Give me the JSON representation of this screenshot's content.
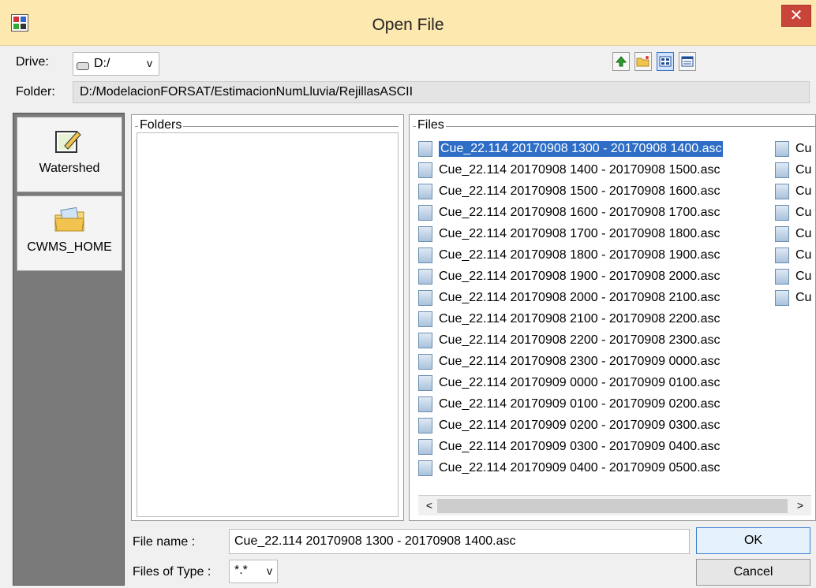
{
  "window": {
    "title": "Open File",
    "close_glyph": "✕"
  },
  "drive": {
    "label": "Drive:",
    "value": "D:/",
    "arrow": "v"
  },
  "folder": {
    "label": "Folder:",
    "path": "D:/ModelacionFORSAT/EstimacionNumLluvia/RejillasASCII"
  },
  "toolbar": {
    "icons": [
      "up-folder-icon",
      "new-folder-icon",
      "list-view-icon",
      "details-view-icon"
    ]
  },
  "shortcuts": [
    {
      "label": "Watershed",
      "icon": "watershed-icon"
    },
    {
      "label": "CWMS_HOME",
      "icon": "folder-icon"
    }
  ],
  "panels": {
    "folders_title": "Folders",
    "files_title": "Files"
  },
  "files": [
    "Cue_22.114 20170908 1300 - 20170908 1400.asc",
    "Cue_22.114 20170908 1400 - 20170908 1500.asc",
    "Cue_22.114 20170908 1500 - 20170908 1600.asc",
    "Cue_22.114 20170908 1600 - 20170908 1700.asc",
    "Cue_22.114 20170908 1700 - 20170908 1800.asc",
    "Cue_22.114 20170908 1800 - 20170908 1900.asc",
    "Cue_22.114 20170908 1900 - 20170908 2000.asc",
    "Cue_22.114 20170908 2000 - 20170908 2100.asc",
    "Cue_22.114 20170908 2100 - 20170908 2200.asc",
    "Cue_22.114 20170908 2200 - 20170908 2300.asc",
    "Cue_22.114 20170908 2300 - 20170909 0000.asc",
    "Cue_22.114 20170909 0000 - 20170909 0100.asc",
    "Cue_22.114 20170909 0100 - 20170909 0200.asc",
    "Cue_22.114 20170909 0200 - 20170909 0300.asc",
    "Cue_22.114 20170909 0300 - 20170909 0400.asc",
    "Cue_22.114 20170909 0400 - 20170909 0500.asc"
  ],
  "selected_file_index": 0,
  "second_column": [
    "Cu",
    "Cu",
    "Cu",
    "Cu",
    "Cu",
    "Cu",
    "Cu",
    "Cu"
  ],
  "scroll": {
    "left_arrow": "<",
    "right_arrow": ">"
  },
  "filename": {
    "label": "File name :",
    "value": "Cue_22.114 20170908 1300 - 20170908 1400.asc"
  },
  "filetype": {
    "label": "Files of Type :",
    "value": "*.*",
    "arrow": "v"
  },
  "buttons": {
    "ok": "OK",
    "cancel": "Cancel"
  }
}
